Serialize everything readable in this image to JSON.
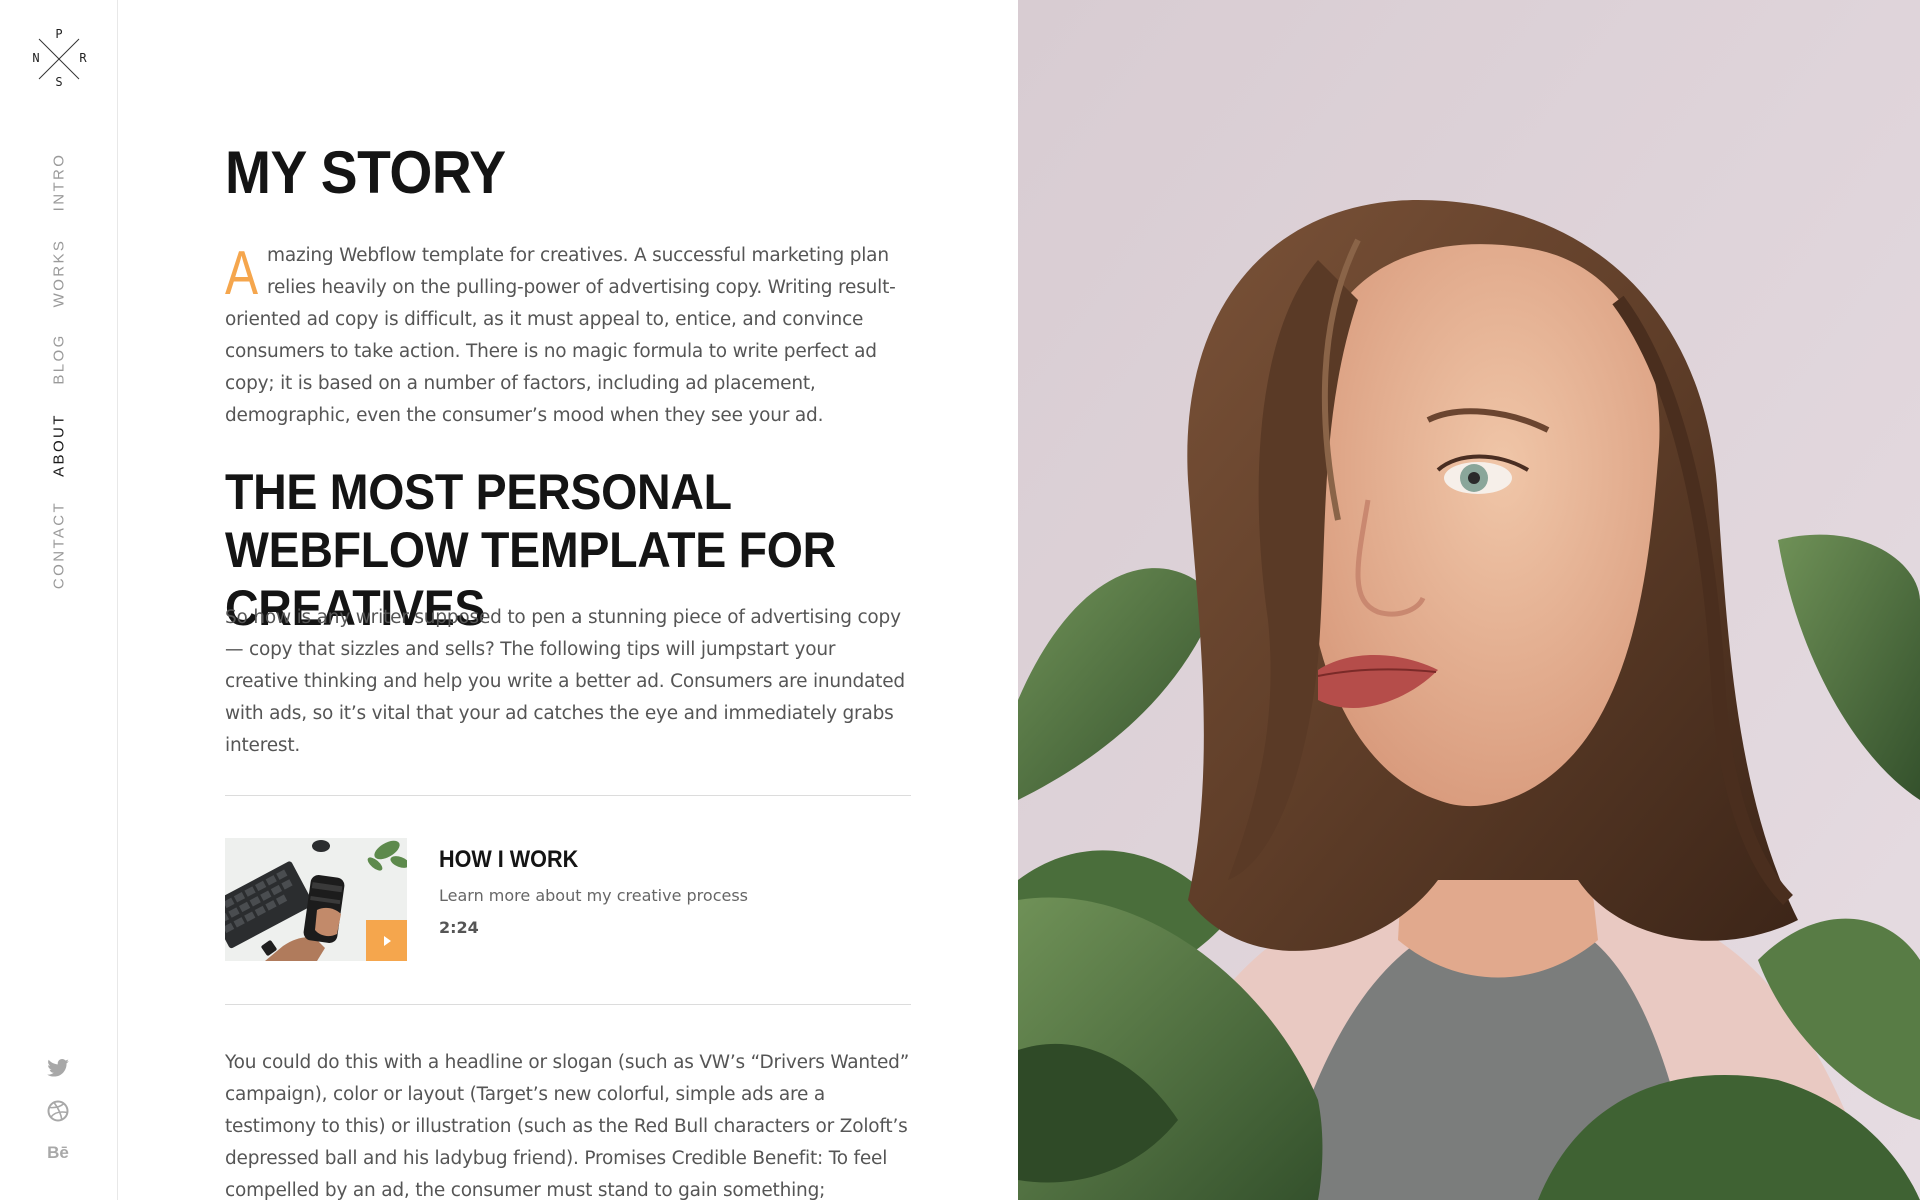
{
  "logo": {
    "top": "P",
    "left": "N",
    "right": "R",
    "bottom": "S"
  },
  "nav": {
    "items": [
      {
        "label": "INTRO"
      },
      {
        "label": "WORKS"
      },
      {
        "label": "BLOG"
      },
      {
        "label": "ABOUT",
        "active": true
      },
      {
        "label": "CONTACT"
      }
    ]
  },
  "social": [
    "twitter-icon",
    "dribbble-icon",
    "behance-icon"
  ],
  "social_behance_label": "Bē",
  "main": {
    "title": "MY STORY",
    "intro_dropcap": "A",
    "intro_rest": "mazing Webflow template for creatives. A successful marketing plan relies heavily on the pulling-power of advertising copy. Writing result-oriented ad copy is difficult, as it must appeal to, entice, and convince consumers to take action. There is no magic formula to write perfect ad copy; it is based on a number of factors, including ad placement, demographic, even the consumer’s mood when they see your ad.",
    "subtitle": "THE MOST PERSONAL WEBFLOW TEMPLATE FOR CREATIVES",
    "paragraph2": "So how is any writer supposed to pen a stunning piece of advertising copy — copy that sizzles and sells? The following tips will jumpstart your creative thinking and help you write a better ad. Consumers are inundated with ads, so it’s vital that your ad catches the eye and immediately grabs interest.",
    "video": {
      "title": "HOW I WORK",
      "subtitle": "Learn more about my creative process",
      "duration": "2:24"
    },
    "paragraph3": "You could do this with a headline or slogan (such as VW’s “Drivers Wanted” campaign), color or layout (Target’s new colorful, simple ads are a testimony to this) or illustration (such as the Red Bull characters or Zoloft’s depressed ball and his ladybug friend). Promises Credible Benefit: To feel compelled by an ad, the consumer must stand to gain something;"
  },
  "colors": {
    "accent": "#f5a64d",
    "heading": "#141414",
    "body": "#555555",
    "nav_inactive": "#9a9a9a"
  }
}
